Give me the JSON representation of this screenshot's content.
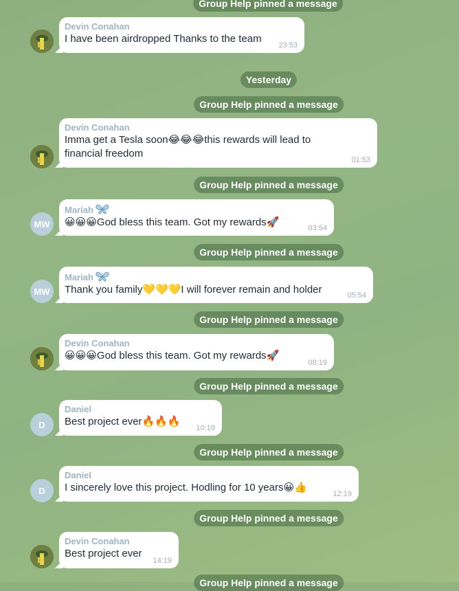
{
  "service_messages": {
    "pinned": "Group Help pinned a message",
    "date_yesterday": "Yesterday"
  },
  "users": {
    "devin": {
      "name": "Devin Conahan",
      "avatar_icon": "photo-avatar"
    },
    "mariah": {
      "name": "Mariah",
      "avatar_initials": "MW",
      "name_emoji": "butterfly-icon"
    },
    "daniel": {
      "name": "Daniel",
      "avatar_initials": "D"
    }
  },
  "messages": [
    {
      "sender": "Devin Conahan",
      "text": "I have been airdropped Thanks to the team",
      "time": "23:53"
    },
    {
      "sender": "Devin Conahan",
      "text_line1": "Imma get a Tesla soon😂😂😂this rewards will lead to",
      "text_line2": "financial freedom",
      "time": "01:53"
    },
    {
      "sender": "Mariah",
      "text": "😀😀😀God bless this team. Got my rewards🚀",
      "time": "03:54"
    },
    {
      "sender": "Mariah",
      "text": "Thank you family💛💛💛I will forever remain and holder",
      "time": "05:54"
    },
    {
      "sender": "Devin Conahan",
      "text": "😀😀😀God bless this team. Got my rewards🚀",
      "time": "08:19"
    },
    {
      "sender": "Daniel",
      "text": "Best project ever🔥🔥🔥",
      "time": "10:19"
    },
    {
      "sender": "Daniel",
      "text": "I sincerely love this project. Hodling for 10 years😀👍",
      "time": "12:19"
    },
    {
      "sender": "Devin Conahan",
      "text": "Best project ever",
      "time": "14:19"
    }
  ],
  "colors": {
    "sender_name": "#9eb5c4",
    "service_bg": "#466941",
    "bubble_bg": "#ffffff"
  }
}
